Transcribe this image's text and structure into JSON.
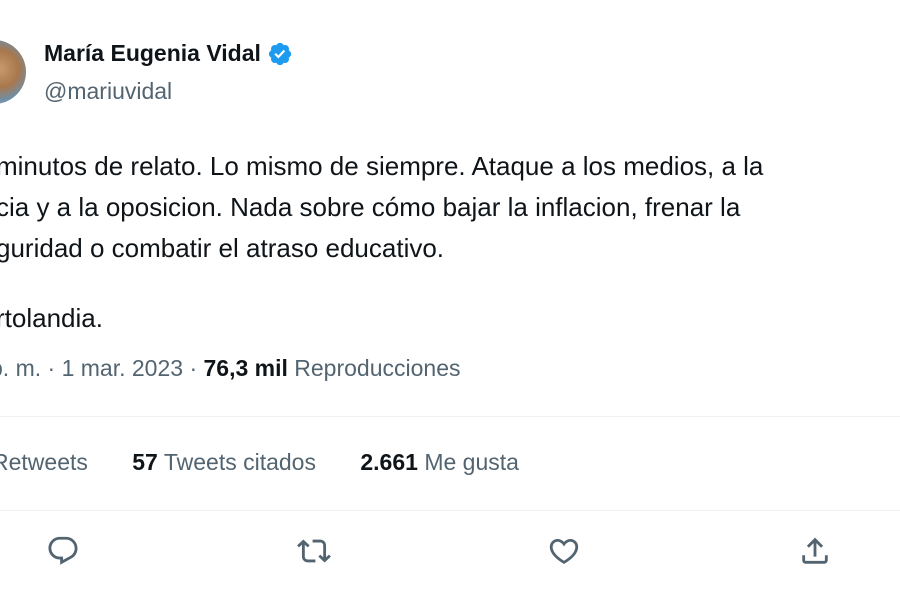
{
  "author": {
    "display_name": "María Eugenia Vidal",
    "handle": "@mariuvidal",
    "verified": true
  },
  "tweet": {
    "lines": [
      "minutos de relato. Lo mismo de siempre. Ataque a los medios, a la",
      "cia y a la oposicion. Nada sobre cómo bajar la inflacion, frenar la",
      "guridad o combatir el atraso educativo.",
      "rtolandia."
    ]
  },
  "meta": {
    "time": "p. m.",
    "separator": "·",
    "date": "1 mar. 2023",
    "views_count": "76,3 mil",
    "views_label": "Reproducciones"
  },
  "stats": {
    "retweets_label": "Retweets",
    "quotes_count": "57",
    "quotes_label": "Tweets citados",
    "likes_count": "2.661",
    "likes_label": "Me gusta"
  },
  "icons": {
    "reply": "reply-icon",
    "retweet": "retweet-icon",
    "like": "like-icon",
    "share": "share-icon",
    "verified": "verified-badge-icon"
  },
  "colors": {
    "text": "#0f1419",
    "secondary": "#536471",
    "verified": "#1d9bf0",
    "divider": "#eff3f4"
  }
}
